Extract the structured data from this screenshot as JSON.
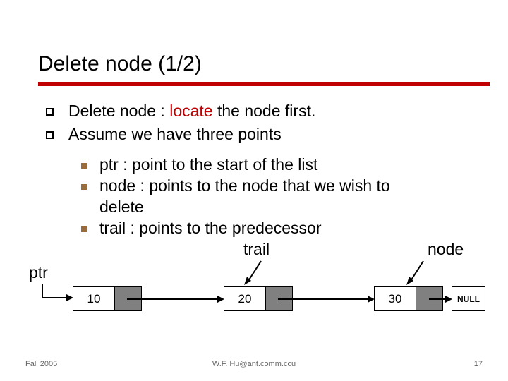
{
  "title": "Delete node (1/2)",
  "bullets": {
    "b1": {
      "pre": "Delete node : ",
      "red": "locate",
      "post": " the node first."
    },
    "b2": "Assume we have three points",
    "sub1": "ptr :  point to the start of the list",
    "sub2a": "node : points to the node that we wish to",
    "sub2b": "delete",
    "sub3": "trail : points to the predecessor"
  },
  "labels": {
    "ptr": "ptr",
    "trail": "trail",
    "node": "node"
  },
  "nodes": {
    "n1": "10",
    "n2": "20",
    "n3": "30",
    "null": "NULL"
  },
  "footer": {
    "left": "Fall 2005",
    "center": "W.F. Hu@ant.comm.ccu",
    "right": "17"
  }
}
